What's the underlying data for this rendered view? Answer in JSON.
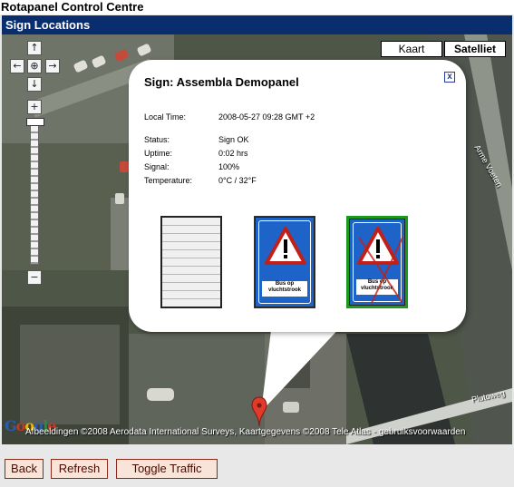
{
  "app": {
    "title": "Rotapanel Control Centre"
  },
  "panel": {
    "title": "Sign Locations"
  },
  "map": {
    "type_buttons": [
      "Kaart",
      "Satelliet"
    ],
    "selected_type": "Satelliet",
    "nav_controls": {
      "up": "↑",
      "left": "←",
      "center": "⊕",
      "right": "→",
      "down": "↓",
      "zoom_in": "+",
      "zoom_out": "−"
    },
    "logo": {
      "letters": [
        "G",
        "o",
        "o",
        "g",
        "l",
        "e"
      ],
      "colors": [
        "#2a5db0",
        "#c0392b",
        "#e8b800",
        "#2a5db0",
        "#2e8b3a",
        "#c0392b"
      ]
    },
    "attribution": "Afbeeldingen ©2008 Aerodata International Surveys, Kaartgegevens ©2008 Tele Atlas - gebruiksvoorwaarden",
    "street_labels": [
      "Arme Voeten",
      "Plutoweg"
    ],
    "marker_color": "#e03a2a"
  },
  "popup": {
    "title": "Sign: Assembla Demopanel",
    "close_label": "x",
    "local_time": {
      "label": "Local Time:",
      "value": "2008-05-27 09:28 GMT +2"
    },
    "status_rows": [
      {
        "label": "Status:",
        "value": "Sign OK"
      },
      {
        "label": "Uptime:",
        "value": "0:02 hrs"
      },
      {
        "label": "Signal:",
        "value": "100%"
      },
      {
        "label": "Temperature:",
        "value": "0°C / 32°F"
      }
    ],
    "sign_text": "Bus op vluchtstrook",
    "selected_border_color": "#1c9a1c"
  },
  "buttons": {
    "back": "Back",
    "refresh": "Refresh",
    "toggle_traffic": "Toggle Traffic"
  }
}
